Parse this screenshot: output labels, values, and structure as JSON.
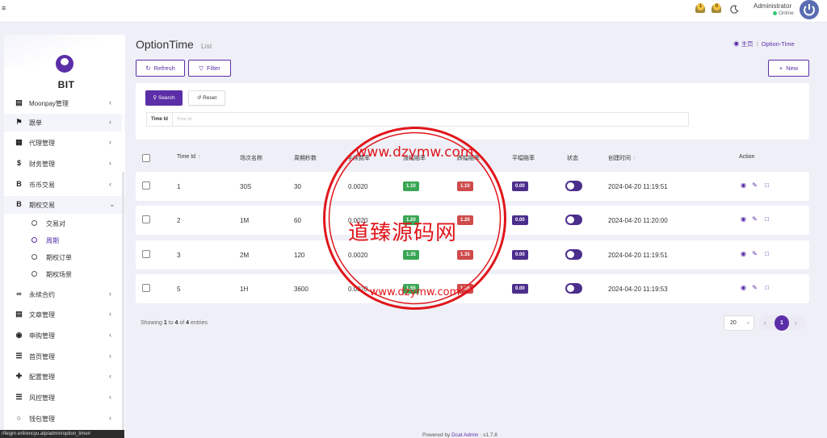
{
  "header": {
    "notifications": [
      "1",
      "0"
    ],
    "admin_name": "Administrator",
    "admin_status": "Online"
  },
  "sidebar": {
    "brand": "BIT",
    "items": [
      {
        "label": "Moonpay管理",
        "icon": "card-icon"
      },
      {
        "label": "跟单",
        "icon": "flag-icon"
      },
      {
        "label": "代理管理",
        "icon": "id-card-icon"
      },
      {
        "label": "财务管理",
        "icon": "dollar-icon"
      },
      {
        "label": "币币交易",
        "icon": "bitcoin-icon"
      },
      {
        "label": "期权交易",
        "icon": "bitcoin-icon"
      },
      {
        "label": "永续合约",
        "icon": "link-icon"
      },
      {
        "label": "文章管理",
        "icon": "card-icon"
      },
      {
        "label": "申购管理",
        "icon": "globe-icon"
      },
      {
        "label": "首页管理",
        "icon": "list-icon"
      },
      {
        "label": "配置管理",
        "icon": "wrench-icon"
      },
      {
        "label": "风控管理",
        "icon": "list-icon"
      },
      {
        "label": "钱包管理",
        "icon": "circle-icon"
      }
    ],
    "sub_items": [
      "交易对",
      "周期",
      "期权订单",
      "期权场景"
    ],
    "active_sub": "周期"
  },
  "status_tip": "//feigrn.eritrencyu.alp/admin/option_time#",
  "page": {
    "title": "OptionTime",
    "subtitle": "List",
    "breadcrumb_home": "主页",
    "breadcrumb_current": "Option-Time"
  },
  "toolbar": {
    "refresh": "Refresh",
    "filter": "Filter",
    "new": "New"
  },
  "filter": {
    "search": "Search",
    "reset": "Reset",
    "field_label": "Time Id",
    "field_placeholder": "Time Id"
  },
  "table": {
    "columns": [
      "Time Id",
      "场次名称",
      "周期秒数",
      "手续费率",
      "涨幅赔率",
      "跌幅赔率",
      "平幅赔率",
      "状态",
      "创建时间",
      "Action"
    ],
    "rows": [
      {
        "id": "1",
        "name": "30S",
        "seconds": "30",
        "fee": "0.0020",
        "up": "1.10",
        "down": "1.10",
        "flat": "0.00",
        "created": "2024-04-20 11:19:51"
      },
      {
        "id": "2",
        "name": "1M",
        "seconds": "60",
        "fee": "0.0020",
        "up": "1.20",
        "down": "1.20",
        "flat": "0.00",
        "created": "2024-04-20 11:20:00"
      },
      {
        "id": "3",
        "name": "2M",
        "seconds": "120",
        "fee": "0.0020",
        "up": "1.35",
        "down": "1.35",
        "flat": "0.00",
        "created": "2024-04-20 11:19:51"
      },
      {
        "id": "5",
        "name": "1H",
        "seconds": "3600",
        "fee": "0.0020",
        "up": "1.55",
        "down": "1.55",
        "flat": "0.00",
        "created": "2024-04-20 11:19:53"
      }
    ]
  },
  "pagination": {
    "showing_prefix": "Showing",
    "from": "1",
    "to_word": "to",
    "to": "4",
    "of_word": "of",
    "total": "4",
    "entries_word": "entries",
    "per_page": "20",
    "current_page": "1"
  },
  "footer": {
    "prefix": "Powered by",
    "link": "Dcat Admin",
    "version": "· v1.7.8"
  },
  "watermark": {
    "text": "道臻源码网",
    "url": "www.dzymw.com"
  },
  "colors": {
    "accent": "#5b2ea8",
    "up": "#3aa655",
    "down": "#cf4b4b",
    "flat": "#4b2d8c",
    "stamp": "#e0161b"
  }
}
